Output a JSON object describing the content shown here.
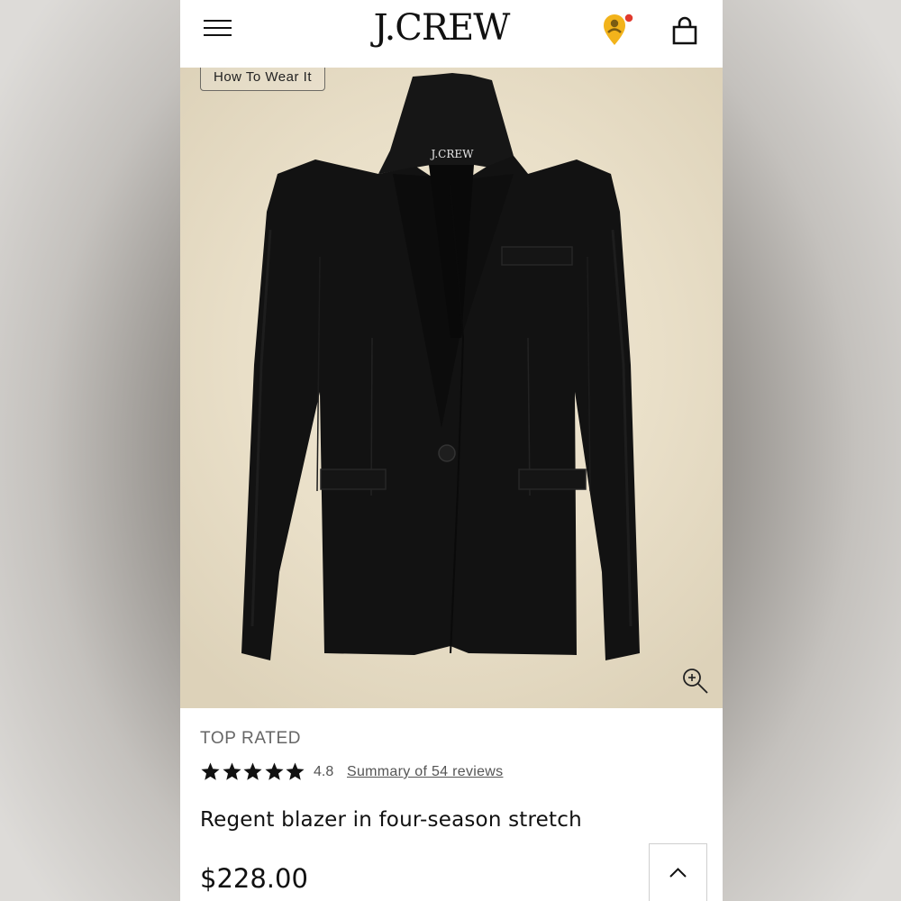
{
  "header": {
    "logo": "J.CREW",
    "menu_icon": "hamburger-menu-icon",
    "location_icon": "location-pin-icon",
    "bag_icon": "shopping-bag-icon",
    "notification_dot_color": "#e03a2e",
    "location_icon_color": "#f2b31b"
  },
  "hero": {
    "how_to_wear_label": "How To Wear It",
    "garment_label": "J.CREW",
    "zoom_icon": "zoom-in-icon"
  },
  "product": {
    "badge": "TOP RATED",
    "rating": {
      "stars": 5,
      "value": "4.8",
      "summary_link": "Summary of 54 reviews"
    },
    "name": "Regent blazer in four-season stretch",
    "price": "$228.00"
  },
  "scroll_top_icon": "chevron-up-icon"
}
